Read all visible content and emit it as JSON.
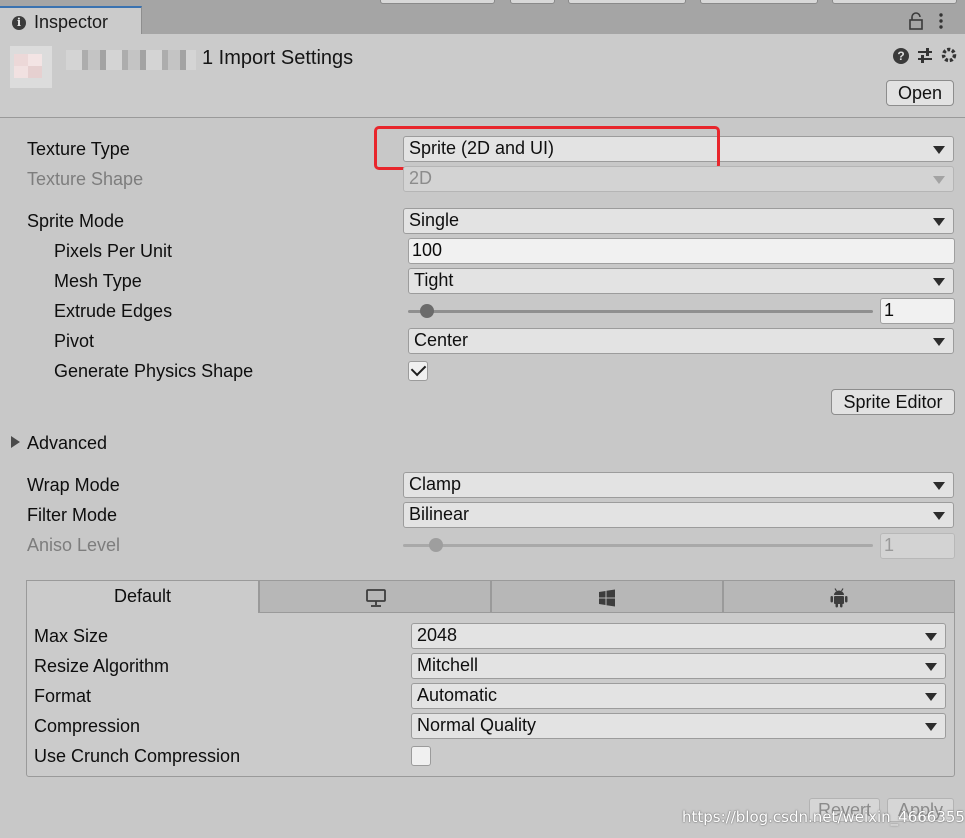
{
  "tab": {
    "label": "Inspector"
  },
  "header": {
    "title": "1 Import Settings",
    "open_label": "Open"
  },
  "fields": {
    "texture_type": {
      "label": "Texture Type",
      "value": "Sprite (2D and UI)"
    },
    "texture_shape": {
      "label": "Texture Shape",
      "value": "2D"
    },
    "sprite_mode": {
      "label": "Sprite Mode",
      "value": "Single"
    },
    "pixels_per_unit": {
      "label": "Pixels Per Unit",
      "value": "100"
    },
    "mesh_type": {
      "label": "Mesh Type",
      "value": "Tight"
    },
    "extrude_edges": {
      "label": "Extrude Edges",
      "value": "1",
      "slider_fraction": 0.04
    },
    "pivot": {
      "label": "Pivot",
      "value": "Center"
    },
    "generate_physics_shape": {
      "label": "Generate Physics Shape",
      "checked": true
    },
    "sprite_editor_label": "Sprite Editor",
    "advanced_label": "Advanced",
    "wrap_mode": {
      "label": "Wrap Mode",
      "value": "Clamp"
    },
    "filter_mode": {
      "label": "Filter Mode",
      "value": "Bilinear"
    },
    "aniso_level": {
      "label": "Aniso Level",
      "value": "1",
      "slider_fraction": 0.07
    }
  },
  "platforms": {
    "tabs": [
      {
        "label": "Default",
        "icon": ""
      },
      {
        "label": "",
        "icon": "monitor-icon"
      },
      {
        "label": "",
        "icon": "windows-icon"
      },
      {
        "label": "",
        "icon": "android-icon"
      }
    ],
    "max_size": {
      "label": "Max Size",
      "value": "2048"
    },
    "resize_algorithm": {
      "label": "Resize Algorithm",
      "value": "Mitchell"
    },
    "format": {
      "label": "Format",
      "value": "Automatic"
    },
    "compression": {
      "label": "Compression",
      "value": "Normal Quality"
    },
    "use_crunch": {
      "label": "Use Crunch Compression",
      "checked": false
    }
  },
  "footer": {
    "revert_label": "Revert",
    "apply_label": "Apply"
  },
  "watermark": "https://blog.csdn.net/weixin_46663555",
  "colors": {
    "highlight_box": "#e8262c",
    "panel_bg": "#c8c8c8",
    "tab_accent": "#3a72b0"
  }
}
